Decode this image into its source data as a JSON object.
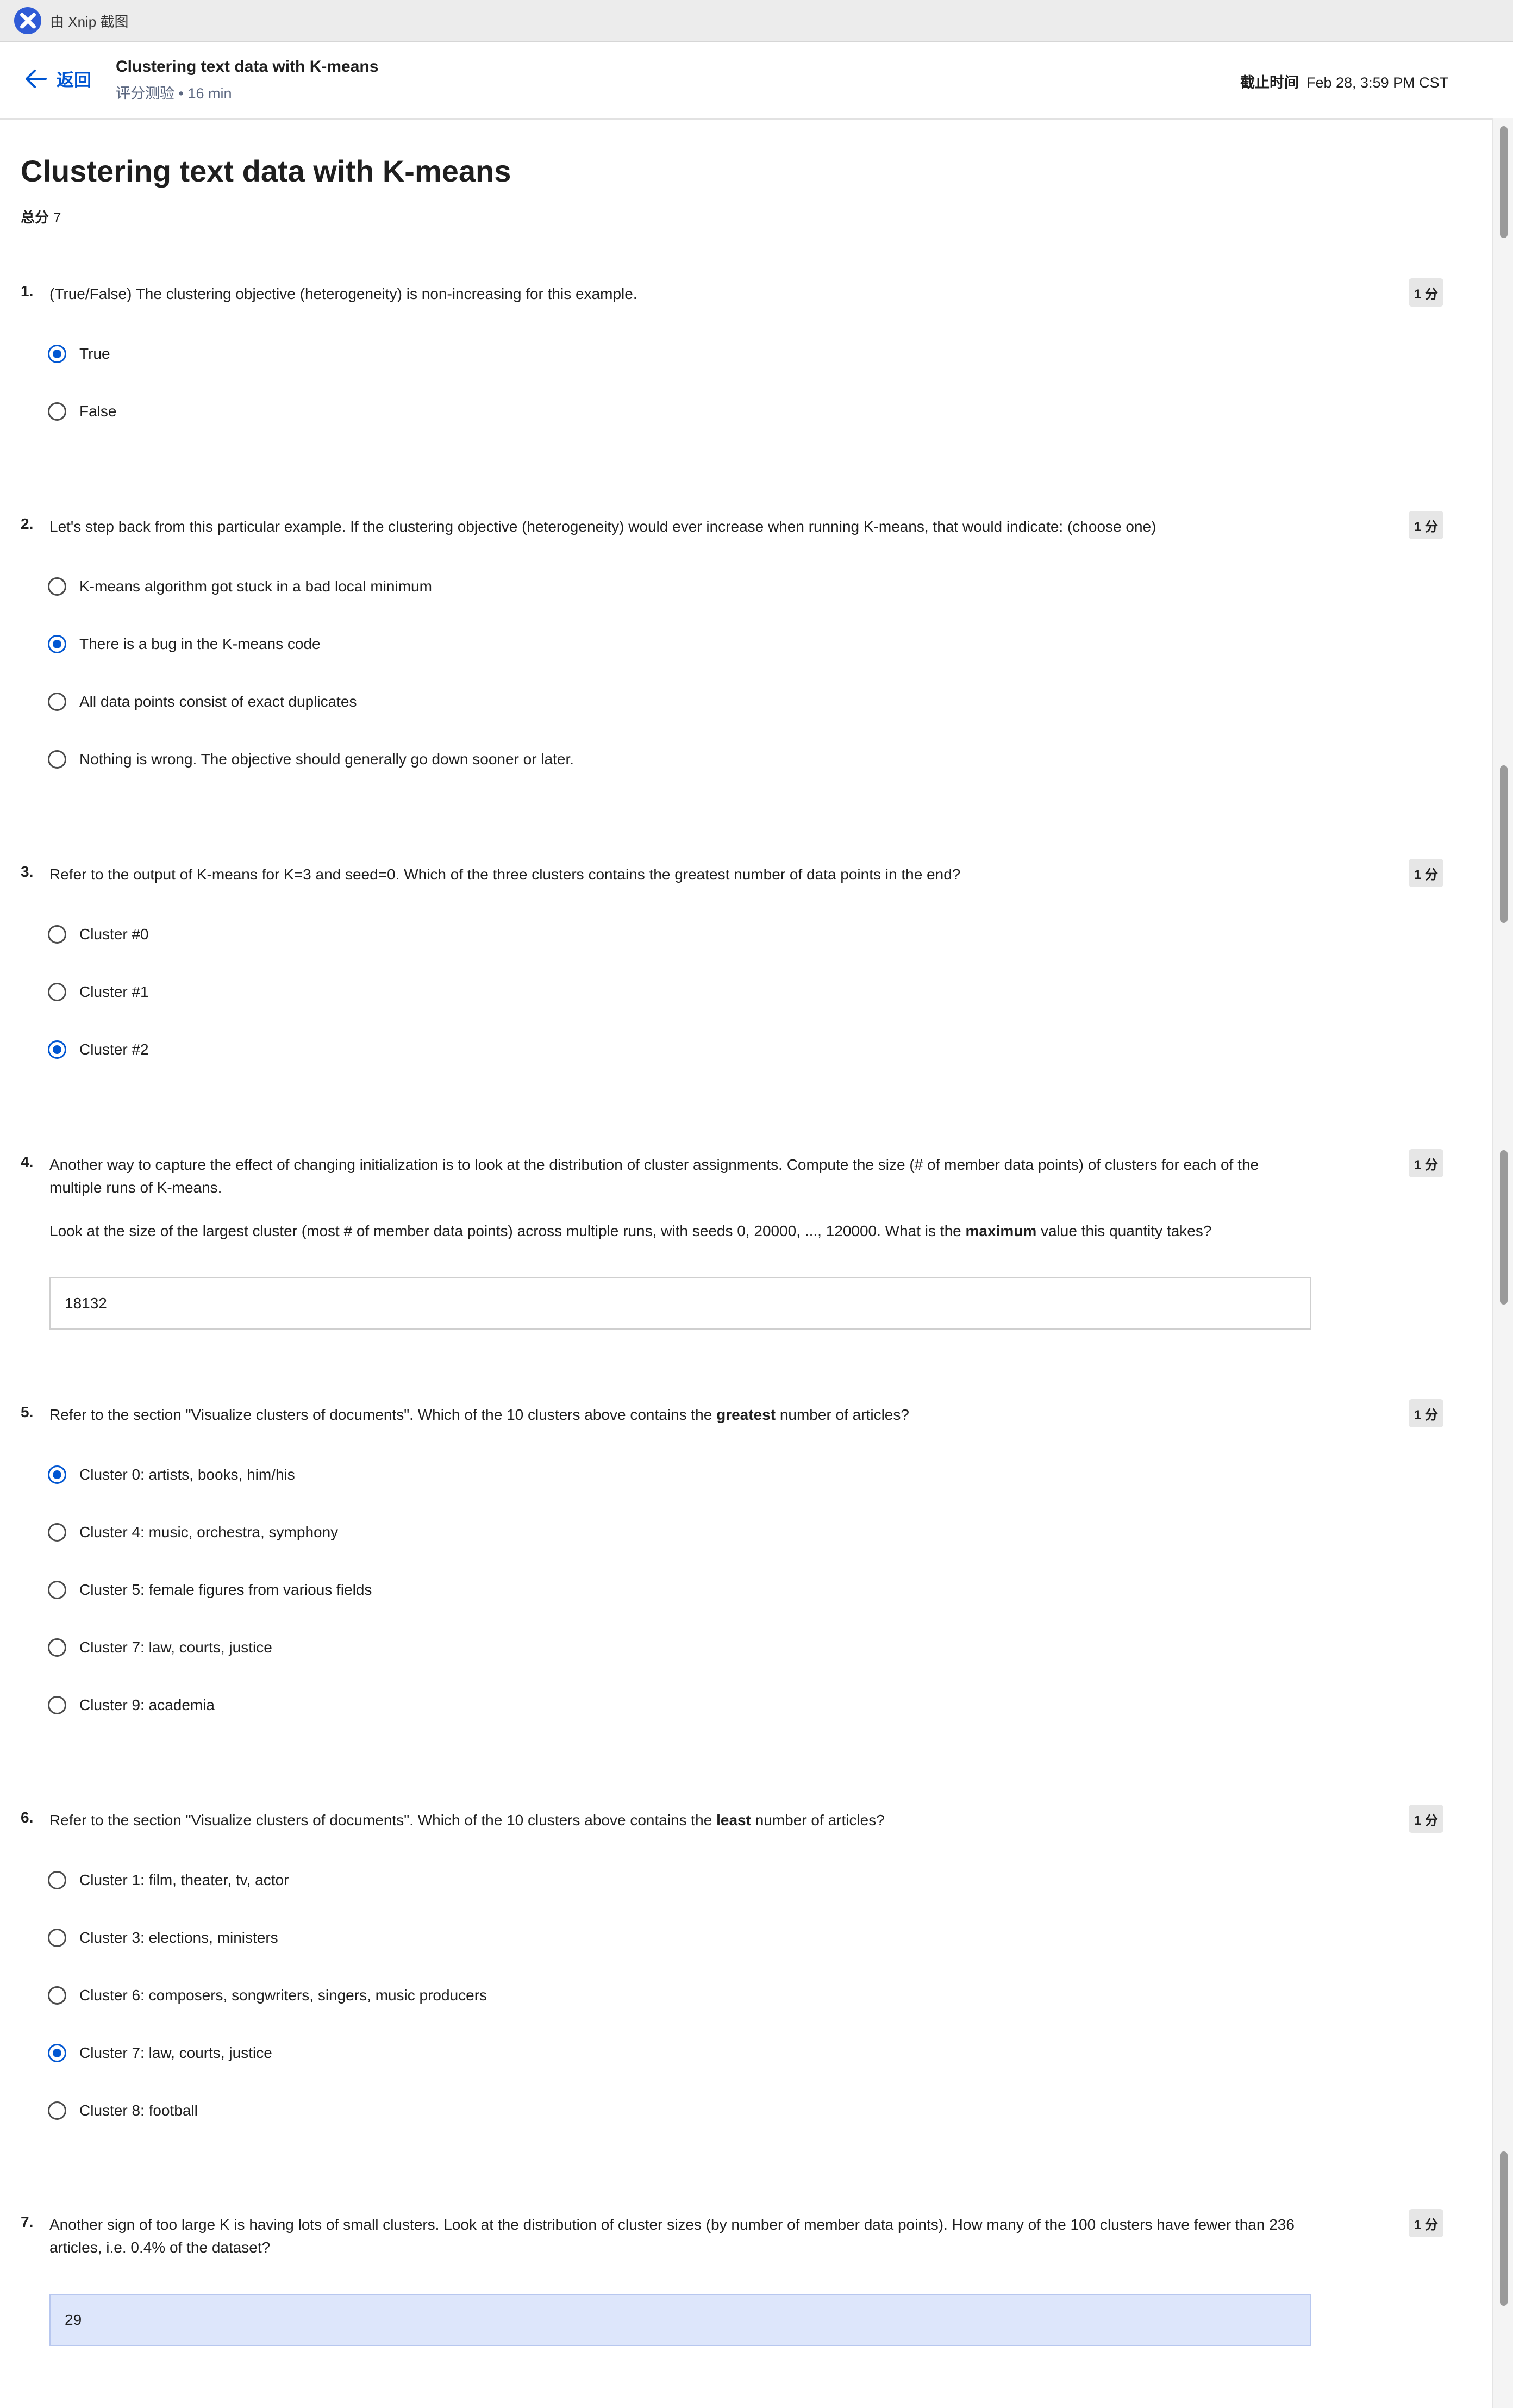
{
  "xnip": {
    "title": "由 Xnip 截图"
  },
  "header": {
    "back_label": "返回",
    "title": "Clustering text data with K-means",
    "subtitle": "评分测验 • 16 min",
    "deadline_label": "截止时间",
    "deadline_value": "Feb 28, 3:59 PM CST"
  },
  "page": {
    "title": "Clustering text data with K-means",
    "total_label": "总分",
    "total_value": "7"
  },
  "questions": [
    {
      "number": "1.",
      "points": "1 分",
      "text": "(True/False) The clustering objective (heterogeneity) is non-increasing for this example.",
      "options": [
        {
          "label": "True",
          "selected": true
        },
        {
          "label": "False",
          "selected": false
        }
      ]
    },
    {
      "number": "2.",
      "points": "1 分",
      "text": "Let's step back from this particular example. If the clustering objective (heterogeneity) would ever increase when running K-means, that would indicate: (choose one)",
      "options": [
        {
          "label": "K-means algorithm got stuck in a bad local minimum",
          "selected": false
        },
        {
          "label": "There is a bug in the K-means code",
          "selected": true
        },
        {
          "label": "All data points consist of exact duplicates",
          "selected": false
        },
        {
          "label": "Nothing is wrong. The objective should generally go down sooner or later.",
          "selected": false
        }
      ]
    },
    {
      "number": "3.",
      "points": "1 分",
      "text": "Refer to the output of K-means for K=3 and seed=0. Which of the three clusters contains the greatest number of data points in the end?",
      "options": [
        {
          "label": "Cluster #0",
          "selected": false
        },
        {
          "label": "Cluster #1",
          "selected": false
        },
        {
          "label": "Cluster #2",
          "selected": true
        }
      ]
    },
    {
      "number": "4.",
      "points": "1 分",
      "text": "Another way to capture the effect of changing initialization is to look at the distribution of cluster assignments. Compute the size (# of member data points) of clusters for each of the multiple runs of K-means.",
      "text2_before": "Look at the size of the largest cluster (most # of member data points) across multiple runs, with seeds 0, 20000, ..., 120000. What is the ",
      "text2_bold": "maximum",
      "text2_after": " value this quantity takes?",
      "answer": "18132"
    },
    {
      "number": "5.",
      "points": "1 分",
      "text_before": "Refer to the section \"Visualize clusters of documents\". Which of the 10 clusters above contains the ",
      "text_bold": "greatest",
      "text_after": " number of articles?",
      "options": [
        {
          "label": "Cluster 0: artists, books, him/his",
          "selected": true
        },
        {
          "label": "Cluster 4: music, orchestra, symphony",
          "selected": false
        },
        {
          "label": "Cluster 5: female figures from various fields",
          "selected": false
        },
        {
          "label": "Cluster 7: law, courts, justice",
          "selected": false
        },
        {
          "label": "Cluster 9: academia",
          "selected": false
        }
      ]
    },
    {
      "number": "6.",
      "points": "1 分",
      "text_before": "Refer to the section \"Visualize clusters of documents\". Which of the 10 clusters above contains the ",
      "text_bold": "least",
      "text_after": " number of articles?",
      "options": [
        {
          "label": "Cluster 1: film, theater, tv, actor",
          "selected": false
        },
        {
          "label": "Cluster 3: elections, ministers",
          "selected": false
        },
        {
          "label": "Cluster 6: composers, songwriters, singers, music producers",
          "selected": false
        },
        {
          "label": "Cluster 7: law, courts, justice",
          "selected": true
        },
        {
          "label": "Cluster 8: football",
          "selected": false
        }
      ]
    },
    {
      "number": "7.",
      "points": "1 分",
      "text": "Another sign of too large K is having lots of small clusters. Look at the distribution of cluster sizes (by number of member data points). How many of the 100 clusters have fewer than 236 articles, i.e. 0.4% of the dataset?",
      "answer": "29"
    }
  ],
  "colors": {
    "accent": "#0056d2",
    "focused_input": "#dde6fb"
  }
}
